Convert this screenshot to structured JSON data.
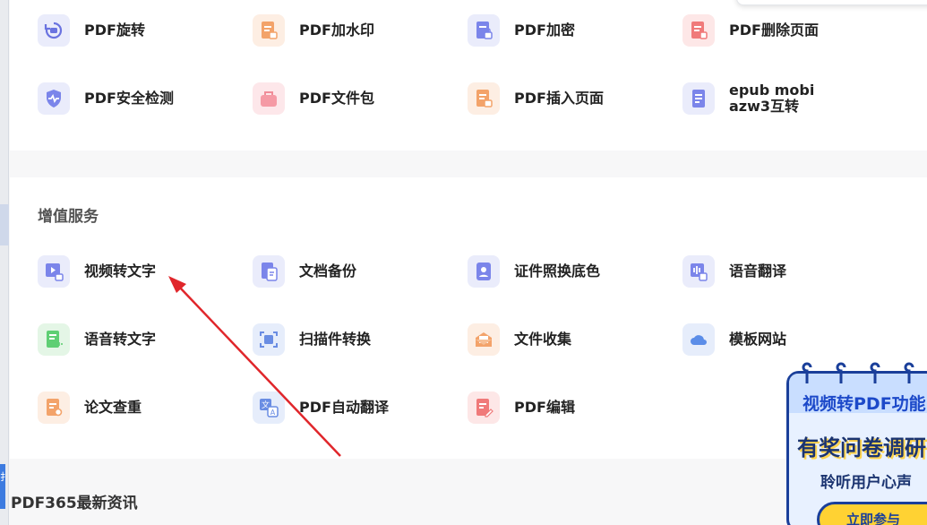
{
  "top_tools": [
    {
      "label": "PDF旋转",
      "icon": "rotate-icon"
    },
    {
      "label": "PDF加水印",
      "icon": "watermark-icon"
    },
    {
      "label": "PDF加密",
      "icon": "lock-document-icon"
    },
    {
      "label": "PDF删除页面",
      "icon": "delete-page-icon"
    },
    {
      "label": "PDF安全检测",
      "icon": "shield-pulse-icon"
    },
    {
      "label": "PDF文件包",
      "icon": "briefcase-icon"
    },
    {
      "label": "PDF插入页面",
      "icon": "insert-page-icon"
    },
    {
      "label": "epub mobi\nazw3互转",
      "icon": "ebook-convert-icon"
    }
  ],
  "value_section": {
    "title": "增值服务",
    "tools": [
      {
        "label": "视频转文字",
        "icon": "video-to-text-icon"
      },
      {
        "label": "文档备份",
        "icon": "document-backup-icon"
      },
      {
        "label": "证件照换底色",
        "icon": "id-photo-icon"
      },
      {
        "label": "语音翻译",
        "icon": "voice-translate-icon"
      },
      {
        "label": "语音转文字",
        "icon": "voice-to-text-icon"
      },
      {
        "label": "扫描件转换",
        "icon": "scan-convert-icon"
      },
      {
        "label": "文件收集",
        "icon": "file-collect-icon"
      },
      {
        "label": "模板网站",
        "icon": "cloud-icon"
      },
      {
        "label": "论文查重",
        "icon": "paper-check-icon"
      },
      {
        "label": "PDF自动翻译",
        "icon": "translate-icon"
      },
      {
        "label": "PDF编辑",
        "icon": "edit-document-icon"
      }
    ]
  },
  "news_section": {
    "title": "PDF365最新资讯"
  },
  "promo": {
    "line1": "视频转PDF功能",
    "line2": "有奖问卷调研",
    "line3": "聆听用户心声",
    "button": "立即参与"
  },
  "left_strip": {
    "text": "扌"
  },
  "colors": {
    "annotation_arrow": "#e0262b",
    "promo_border": "#1a3f9a",
    "promo_button": "#ffd233"
  }
}
